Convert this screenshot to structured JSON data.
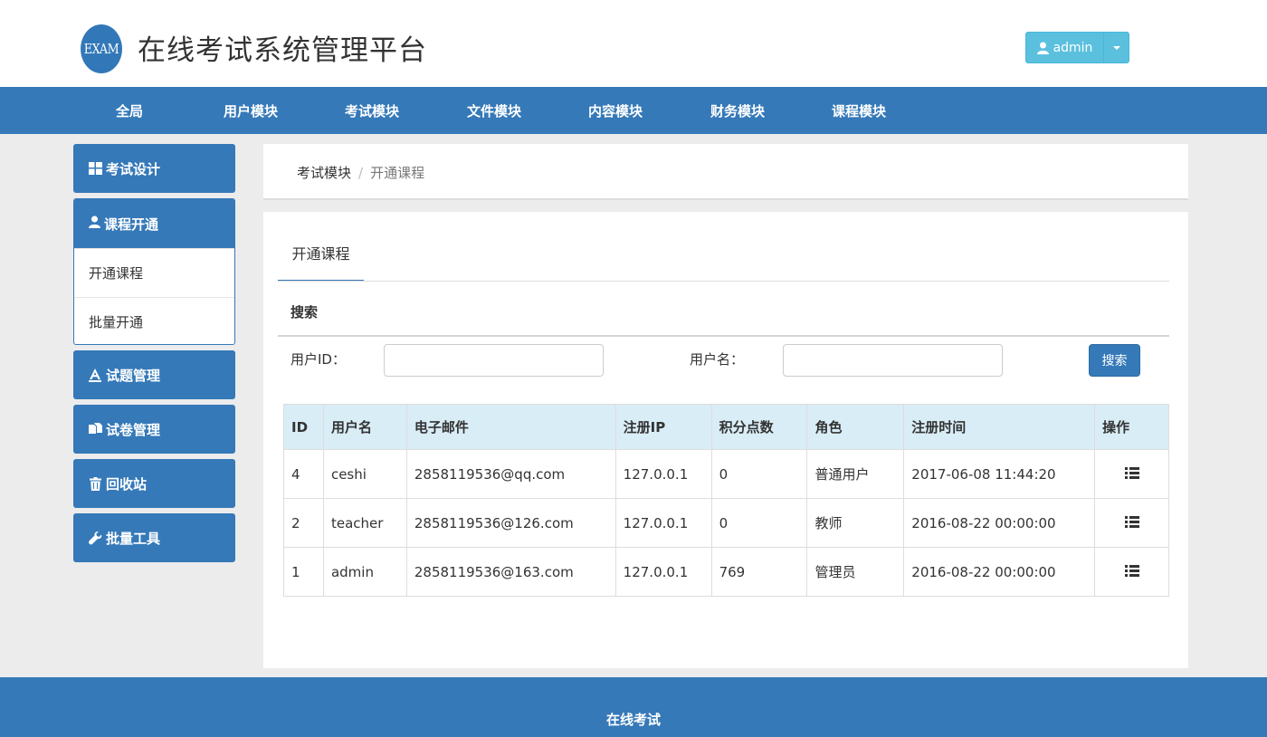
{
  "header": {
    "logo_text": "EXAM",
    "title": "在线考试系统管理平台",
    "user_label": "admin"
  },
  "topnav": {
    "items": [
      "全局",
      "用户模块",
      "考试模块",
      "文件模块",
      "内容模块",
      "财务模块",
      "课程模块"
    ]
  },
  "sidebar": {
    "exam_design": "考试设计",
    "course_open": "课程开通",
    "sub_items": [
      "开通课程",
      "批量开通"
    ],
    "question_mgmt": "试题管理",
    "paper_mgmt": "试卷管理",
    "recycle": "回收站",
    "batch_tools": "批量工具"
  },
  "breadcrumb": {
    "parent": "考试模块",
    "separator": "/",
    "current": "开通课程"
  },
  "main": {
    "tab_label": "开通课程",
    "search_title": "搜索",
    "user_id_label": "用户ID：",
    "user_id_value": "",
    "username_label": "用户名：",
    "username_value": "",
    "search_button": "搜索"
  },
  "table": {
    "columns": [
      "ID",
      "用户名",
      "电子邮件",
      "注册IP",
      "积分点数",
      "角色",
      "注册时间",
      "操作"
    ],
    "rows": [
      {
        "id": "4",
        "username": "ceshi",
        "email": "2858119536@qq.com",
        "ip": "127.0.0.1",
        "points": "0",
        "role": "普通用户",
        "reg_time": "2017-06-08 11:44:20"
      },
      {
        "id": "2",
        "username": "teacher",
        "email": "2858119536@126.com",
        "ip": "127.0.0.1",
        "points": "0",
        "role": "教师",
        "reg_time": "2016-08-22 00:00:00"
      },
      {
        "id": "1",
        "username": "admin",
        "email": "2858119536@163.com",
        "ip": "127.0.0.1",
        "points": "769",
        "role": "管理员",
        "reg_time": "2016-08-22 00:00:00"
      }
    ]
  },
  "footer": {
    "text": "在线考试"
  },
  "colors": {
    "primary": "#3579b8",
    "info": "#5bc0de",
    "table_head": "#d9edf7"
  }
}
